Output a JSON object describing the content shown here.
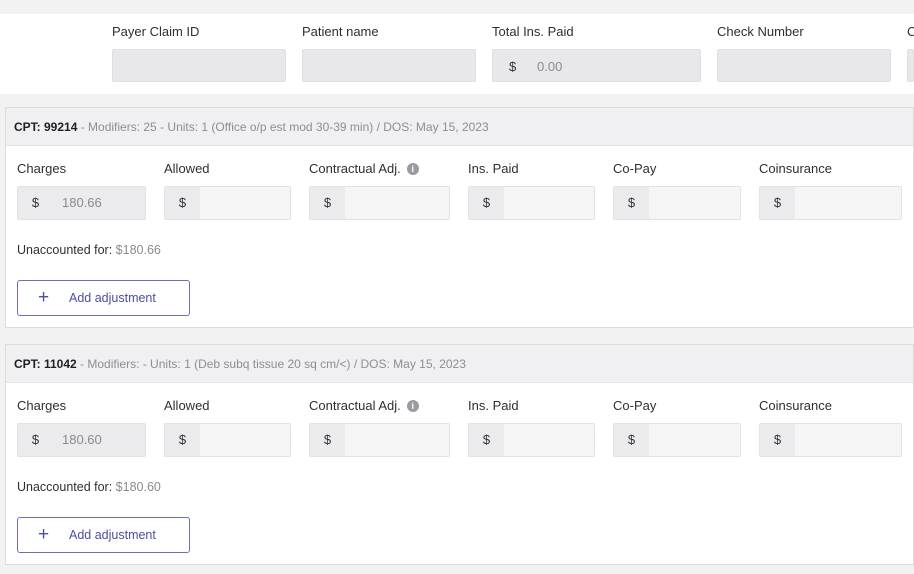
{
  "header": {
    "columns": [
      {
        "label": "Payer Claim ID",
        "value": "",
        "prefix": ""
      },
      {
        "label": "Patient name",
        "value": "",
        "prefix": ""
      },
      {
        "label": "Total Ins. Paid",
        "value": "0.00",
        "prefix": "$"
      },
      {
        "label": "Check Number",
        "value": "",
        "prefix": ""
      },
      {
        "label": "C",
        "value": "",
        "prefix": ""
      }
    ]
  },
  "field_labels": {
    "charges": "Charges",
    "allowed": "Allowed",
    "contractual": "Contractual Adj.",
    "ins_paid": "Ins. Paid",
    "copay": "Co-Pay",
    "coinsurance": "Coinsurance"
  },
  "currency": "$",
  "info_glyph": "i",
  "add_adjustment_label": "Add adjustment",
  "add_icon": "+",
  "unaccounted_label": "Unaccounted for: ",
  "lines": [
    {
      "cpt": "CPT: 99214",
      "meta": " - Modifiers: 25 - Units: 1 (Office o/p est mod 30-39 min) / DOS: May 15, 2023",
      "charges": "180.66",
      "unaccounted": "$180.66"
    },
    {
      "cpt": "CPT: 11042",
      "meta": " - Modifiers: - Units: 1 (Deb subq tissue 20 sq cm/<) / DOS: May 15, 2023",
      "charges": "180.60",
      "unaccounted": "$180.60"
    }
  ],
  "colors": {
    "accent": "#4a4f9e",
    "field_bg": "#ebebed",
    "card_header_bg": "#f0f0f2"
  }
}
